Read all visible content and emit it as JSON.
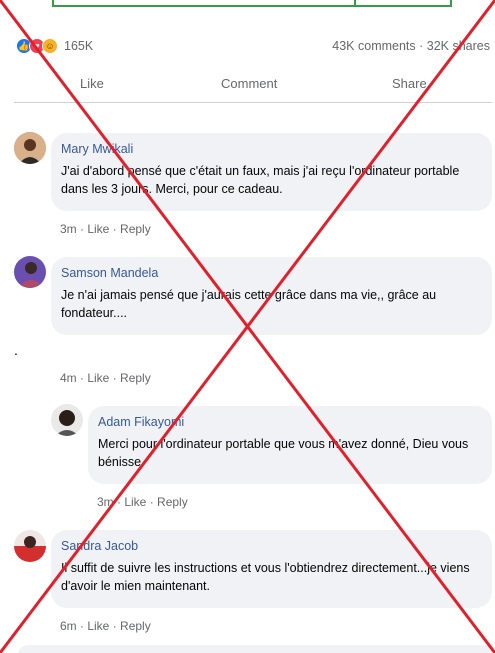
{
  "post": {
    "reaction_count": "165K",
    "comments_shares": "43K comments · 32K shares",
    "actions": {
      "like": "Like",
      "comment": "Comment",
      "share": "Share"
    }
  },
  "comments": [
    {
      "author": "Mary Mwikali",
      "text": "J'ai d'abord pensé que c'était un faux, mais j'ai reçu l'ordinateur portable dans les 3 jours. Merci, pour ce cadeau.",
      "time": "3m",
      "like": "Like",
      "reply": "Reply"
    },
    {
      "author": "Samson Mandela",
      "text": "Je n'ai jamais pensé que j'aurais cette grâce dans ma vie,, grâce au fondateur....",
      "time": "4m",
      "like": "Like",
      "reply": "Reply"
    },
    {
      "author": "Adam Fikayomi",
      "text": "Merci pour l'ordinateur portable que vous m'avez donné, Dieu vous bénisse.",
      "time": "3m",
      "like": "Like",
      "reply": "Reply"
    },
    {
      "author": "Sandra Jacob",
      "text": "Il suffit de suivre les instructions et vous l'obtiendrez directement...je viens d'avoir le mien maintenant.",
      "time": "6m",
      "like": "Like",
      "reply": "Reply"
    }
  ],
  "stray_mark": ".",
  "colors": {
    "accent": "#1877f2",
    "name": "#385898",
    "bubble": "#f0f2f5",
    "muted": "#65676b",
    "cross": "#e0202a"
  },
  "icons": [
    "like-reaction-icon",
    "love-reaction-icon",
    "care-reaction-icon"
  ]
}
